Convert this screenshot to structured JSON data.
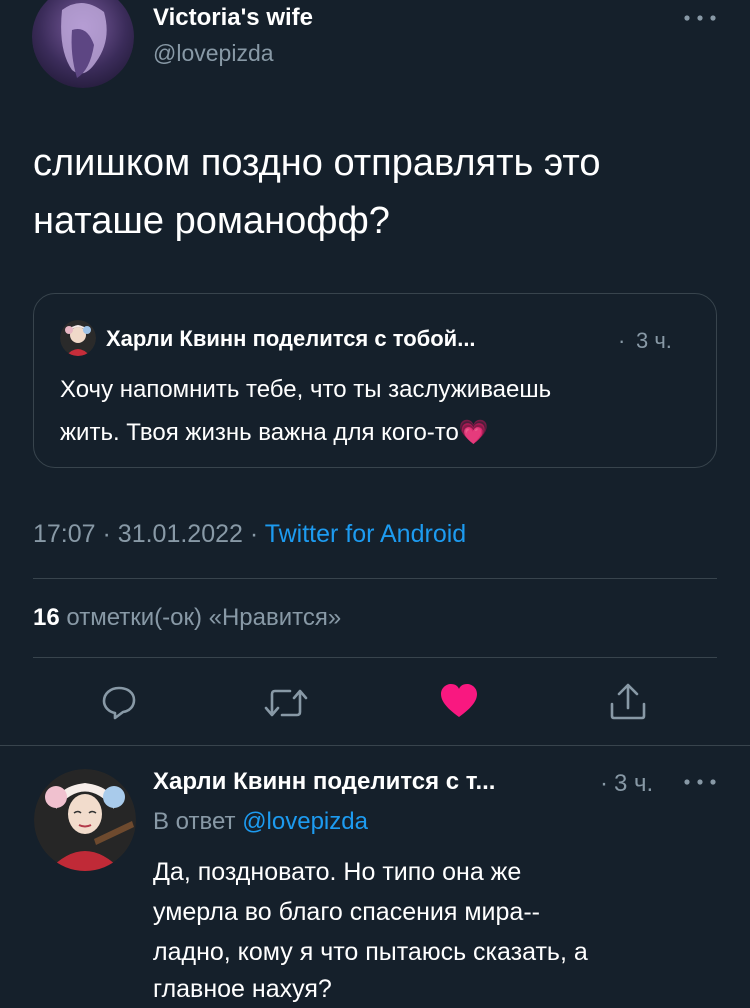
{
  "tweet": {
    "author_name": "Victoria's wife",
    "author_handle": "@lovepizda",
    "more_icon": "more-horizontal-icon",
    "text_line1": "слишком поздно отправлять это",
    "text_line2": "наташе романофф?",
    "quote": {
      "author_name": "Харли Квинн поделится с тобой...",
      "separator": "·",
      "time": "3 ч.",
      "text_line1": "Хочу напомнить тебе, что ты заслуживаешь",
      "text_line2": "жить. Твоя жизнь важна для кого-то",
      "emoji": "💗"
    },
    "meta": {
      "time": "17:07",
      "sep1": "·",
      "date": "31.01.2022",
      "sep2": "·",
      "source": "Twitter for Android"
    },
    "likes": {
      "count": "16",
      "label": "отметки(-ок) «Нравится»"
    },
    "actions": {
      "reply_icon": "reply-icon",
      "retweet_icon": "retweet-icon",
      "like_icon": "heart-filled-icon",
      "share_icon": "share-icon"
    },
    "colors": {
      "background": "#15202b",
      "muted": "#8899a6",
      "link": "#1d9bf0",
      "like": "#f91880",
      "divider": "#38444d"
    }
  },
  "reply": {
    "author_name": "Харли Квинн поделится с т...",
    "separator": "·",
    "time": "3 ч.",
    "more_icon": "more-horizontal-icon",
    "reply_to_label": "В ответ",
    "reply_to_handle": "@lovepizda",
    "text_line1": "Да, поздновато. Но типо она же",
    "text_line2": "умерла во благо спасения мира--",
    "text_line3": "ладно, кому я что пытаюсь сказать, а",
    "text_line4": "главное нахуя?"
  }
}
